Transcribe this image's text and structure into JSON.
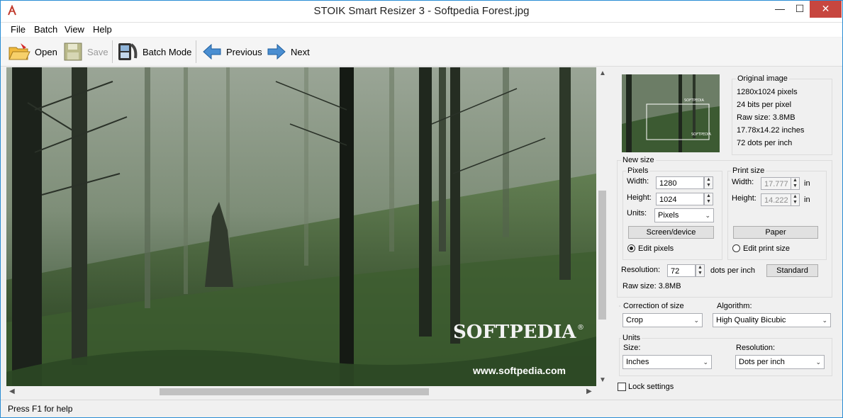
{
  "window": {
    "title": "STOIK Smart Resizer 3 - Softpedia Forest.jpg",
    "minimize": "—",
    "maximize": "☐",
    "close": "✕"
  },
  "menu": [
    "File",
    "Batch",
    "View",
    "Help"
  ],
  "toolbar": {
    "open": "Open",
    "save": "Save",
    "batch_mode": "Batch Mode",
    "previous": "Previous",
    "next": "Next"
  },
  "image": {
    "watermark": "SOFTPEDIA",
    "registered": "®",
    "url": "www.softpedia.com"
  },
  "thumbnail": {
    "watermark_top": "SOFTPEDIA",
    "watermark_bottom": "SOFTPEDIA"
  },
  "original_image": {
    "title": "Original image",
    "pixels": "1280x1024 pixels",
    "bits": "24 bits per pixel",
    "raw_size": "Raw size: 3.8MB",
    "inches": "17.78x14.22 inches",
    "dpi": "72 dots per inch"
  },
  "new_size": {
    "title": "New size",
    "pixels_group": "Pixels",
    "width_label": "Width:",
    "width_value": "1280",
    "height_label": "Height:",
    "height_value": "1024",
    "units_label": "Units:",
    "units_value": "Pixels",
    "screen_button": "Screen/device",
    "edit_pixels": "Edit pixels",
    "print_group": "Print size",
    "print_width_label": "Width:",
    "print_width_value": "17.777",
    "print_height_label": "Height:",
    "print_height_value": "14.222",
    "in_unit": "in",
    "paper_button": "Paper",
    "edit_print": "Edit print size",
    "resolution_label": "Resolution:",
    "resolution_value": "72",
    "resolution_unit": "dots per inch",
    "standard_button": "Standard",
    "raw_size": "Raw size: 3.8MB"
  },
  "correction": {
    "label": "Correction of size",
    "value": "Crop"
  },
  "algorithm": {
    "label": "Algorithm:",
    "value": "High Quality Bicubic"
  },
  "units": {
    "title": "Units",
    "size_label": "Size:",
    "size_value": "Inches",
    "resolution_label": "Resolution:",
    "resolution_value": "Dots per inch"
  },
  "lock_settings": "Lock settings",
  "status": "Press F1 for help",
  "icons": {
    "spin_up": "▲",
    "spin_down": "▼",
    "caret": "⌄",
    "scroll_up": "▲",
    "scroll_down": "▼",
    "scroll_left": "◀",
    "scroll_right": "▶"
  }
}
